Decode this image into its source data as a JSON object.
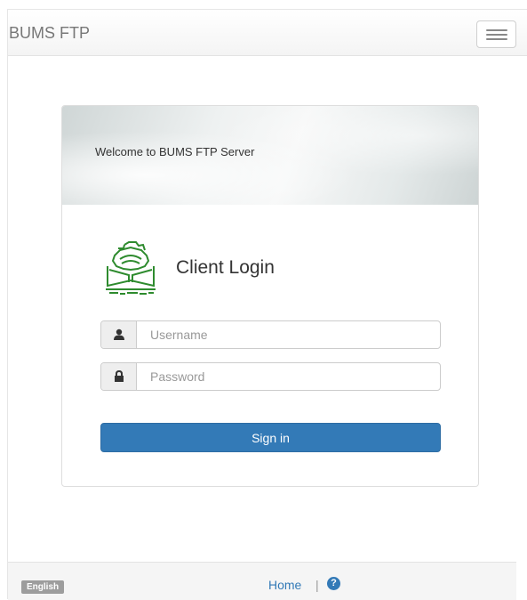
{
  "navbar": {
    "brand": "BUMS FTP",
    "toggle_icon": "hamburger-menu-icon"
  },
  "panel": {
    "welcome": "Welcome to BUMS FTP Server",
    "logo_icon": "university-logo",
    "title": "Client Login",
    "username": {
      "placeholder": "Username",
      "value": "",
      "icon": "user-icon"
    },
    "password": {
      "placeholder": "Password",
      "value": "",
      "icon": "lock-icon"
    },
    "signin_label": "Sign in"
  },
  "footer": {
    "language": "English",
    "home_label": "Home",
    "separator": "|",
    "help_icon": "question-circle-icon",
    "help_glyph": "?"
  },
  "colors": {
    "primary": "#337ab7",
    "logo_green": "#2e8b2e",
    "language_badge": "#9d9d9d"
  }
}
